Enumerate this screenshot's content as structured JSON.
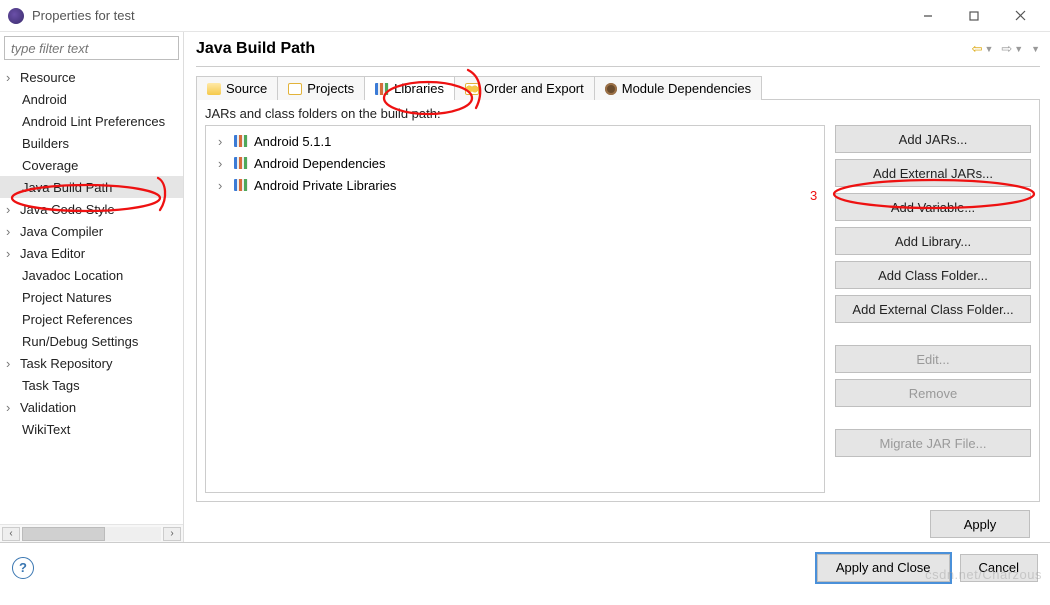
{
  "window": {
    "title": "Properties for test"
  },
  "filter": {
    "placeholder": "type filter text"
  },
  "nav": {
    "items": [
      {
        "label": "Resource",
        "expandable": true
      },
      {
        "label": "Android",
        "expandable": false
      },
      {
        "label": "Android Lint Preferences",
        "expandable": false
      },
      {
        "label": "Builders",
        "expandable": false
      },
      {
        "label": "Coverage",
        "expandable": false
      },
      {
        "label": "Java Build Path",
        "expandable": false,
        "selected": true
      },
      {
        "label": "Java Code Style",
        "expandable": true
      },
      {
        "label": "Java Compiler",
        "expandable": true
      },
      {
        "label": "Java Editor",
        "expandable": true
      },
      {
        "label": "Javadoc Location",
        "expandable": false
      },
      {
        "label": "Project Natures",
        "expandable": false
      },
      {
        "label": "Project References",
        "expandable": false
      },
      {
        "label": "Run/Debug Settings",
        "expandable": false
      },
      {
        "label": "Task Repository",
        "expandable": true
      },
      {
        "label": "Task Tags",
        "expandable": false
      },
      {
        "label": "Validation",
        "expandable": true
      },
      {
        "label": "WikiText",
        "expandable": false
      }
    ]
  },
  "heading": "Java Build Path",
  "tabs": [
    {
      "label": "Source",
      "icon": "source-icon"
    },
    {
      "label": "Projects",
      "icon": "projects-icon"
    },
    {
      "label": "Libraries",
      "icon": "libraries-icon",
      "active": true
    },
    {
      "label": "Order and Export",
      "icon": "order-export-icon"
    },
    {
      "label": "Module Dependencies",
      "icon": "module-deps-icon"
    }
  ],
  "libraries": {
    "description": "JARs and class folders on the build path:",
    "items": [
      {
        "label": "Android 5.1.1"
      },
      {
        "label": "Android Dependencies"
      },
      {
        "label": "Android Private Libraries"
      }
    ],
    "buttons": {
      "add_jars": "Add JARs...",
      "add_external_jars": "Add External JARs...",
      "add_variable": "Add Variable...",
      "add_library": "Add Library...",
      "add_class_folder": "Add Class Folder...",
      "add_external_class_folder": "Add External Class Folder...",
      "edit": "Edit...",
      "remove": "Remove",
      "migrate": "Migrate JAR File..."
    }
  },
  "footer": {
    "apply": "Apply",
    "apply_close": "Apply and Close",
    "cancel": "Cancel"
  },
  "annotations": {
    "step_label": "3"
  },
  "watermark": "csdn.net/Charzous"
}
